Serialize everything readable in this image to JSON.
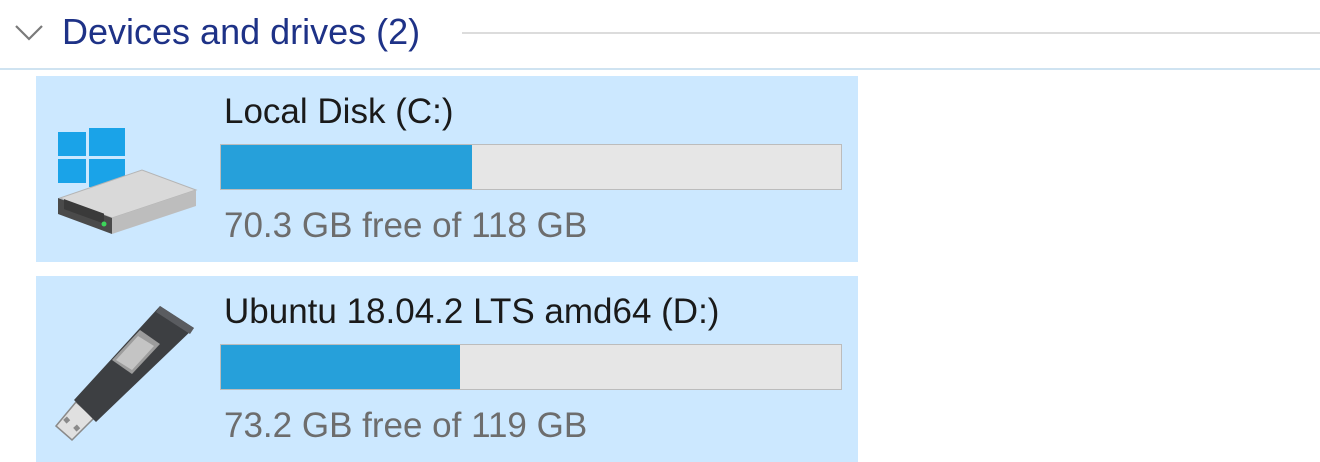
{
  "group": {
    "title": "Devices and drives (2)",
    "expanded": true,
    "chevron_icon": "chevron-down-icon"
  },
  "drives": [
    {
      "name": "Local Disk (C:)",
      "space_text": "70.3 GB free of 118 GB",
      "used_fraction": 0.405,
      "icon": "windows-hard-drive-icon"
    },
    {
      "name": "Ubuntu 18.04.2 LTS amd64 (D:)",
      "space_text": "73.2 GB free of 119 GB",
      "used_fraction": 0.385,
      "icon": "usb-flash-drive-icon"
    }
  ],
  "colors": {
    "header_text": "#1e3287",
    "selection_bg": "#cce8ff",
    "usage_fill": "#26a0da",
    "usage_track": "#e6e6e6",
    "free_text": "#6d6d6d"
  }
}
